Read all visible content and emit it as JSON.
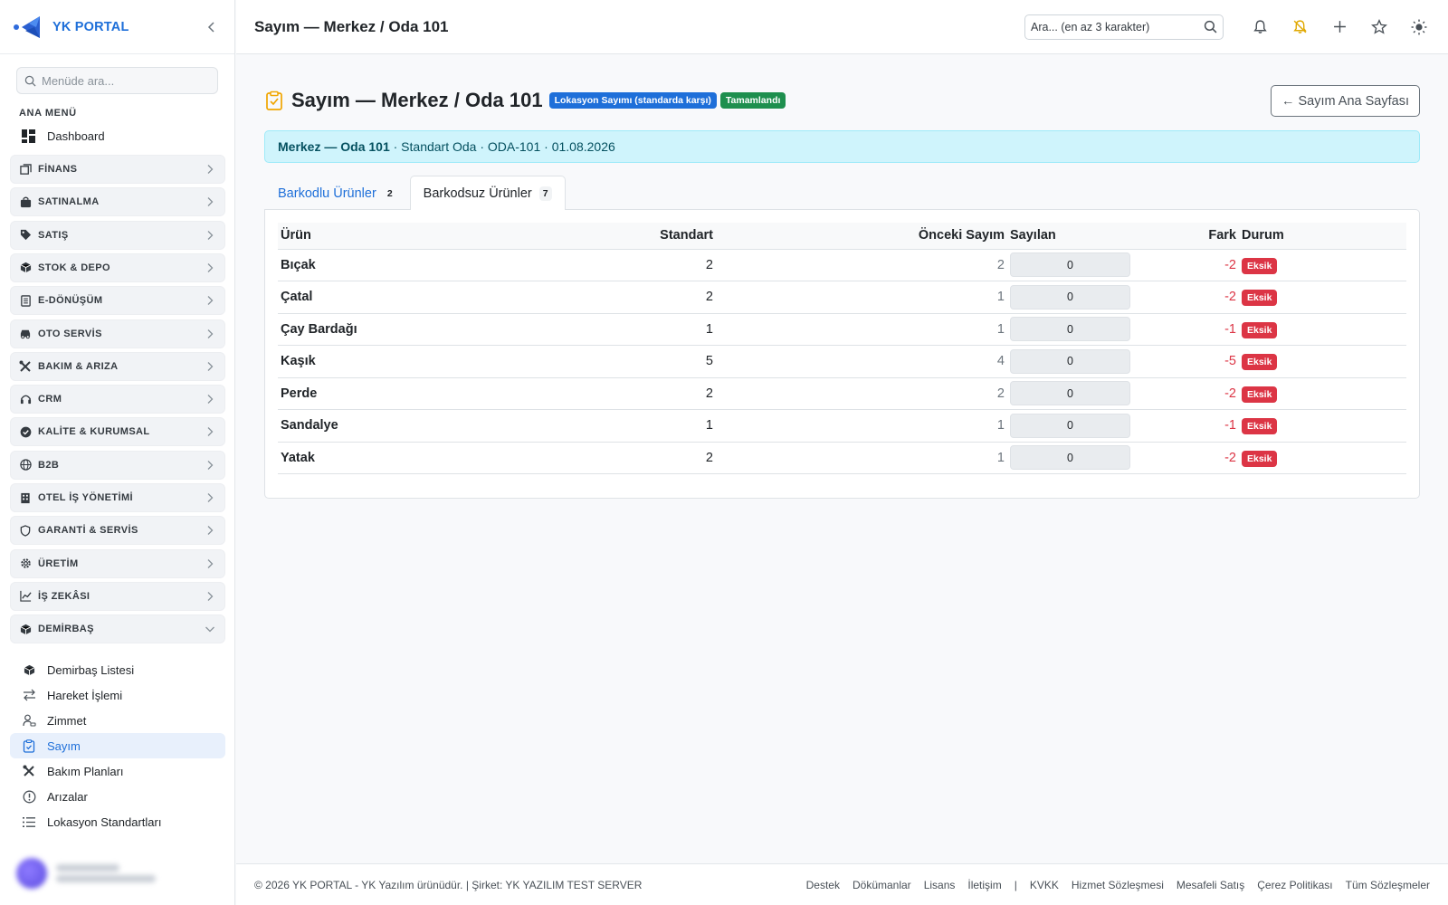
{
  "app": {
    "name": "YK PORTAL"
  },
  "sidebar": {
    "search_placeholder": "Menüde ara...",
    "section_title": "ANA MENÜ",
    "dashboard": "Dashboard",
    "groups": [
      {
        "label": "FİNANS",
        "icon": "finance-icon"
      },
      {
        "label": "SATINALMA",
        "icon": "bag-icon"
      },
      {
        "label": "SATIŞ",
        "icon": "tag-icon"
      },
      {
        "label": "STOK & DEPO",
        "icon": "box-icon"
      },
      {
        "label": "E-DÖNÜŞÜM",
        "icon": "document-icon"
      },
      {
        "label": "OTO SERVİS",
        "icon": "car-icon"
      },
      {
        "label": "BAKIM & ARIZA",
        "icon": "tools-icon"
      },
      {
        "label": "CRM",
        "icon": "headset-icon"
      },
      {
        "label": "KALİTE & KURUMSAL",
        "icon": "check-badge-icon"
      },
      {
        "label": "B2B",
        "icon": "globe-icon"
      },
      {
        "label": "OTEL İŞ YÖNETİMİ",
        "icon": "building-icon"
      },
      {
        "label": "GARANTİ & SERVİS",
        "icon": "shield-icon"
      },
      {
        "label": "ÜRETİM",
        "icon": "gear-icon"
      },
      {
        "label": "İŞ ZEKÂSI",
        "icon": "chart-icon"
      },
      {
        "label": "DEMİRBAŞ",
        "icon": "box-icon"
      }
    ],
    "sub_items": [
      {
        "label": "Demirbaş Listesi",
        "icon": "box-icon"
      },
      {
        "label": "Hareket İşlemi",
        "icon": "arrows-icon"
      },
      {
        "label": "Zimmet",
        "icon": "person-icon"
      },
      {
        "label": "Sayım",
        "icon": "clipboard-icon"
      },
      {
        "label": "Bakım Planları",
        "icon": "tools-icon"
      },
      {
        "label": "Arızalar",
        "icon": "alert-icon"
      },
      {
        "label": "Lokasyon Standartları",
        "icon": "list-icon"
      }
    ]
  },
  "topbar": {
    "title": "Sayım — Merkez / Oda 101",
    "search_placeholder": "Ara... (en az 3 karakter)"
  },
  "page": {
    "title": "Sayım — Merkez / Oda 101",
    "badge_type": "Lokasyon Sayımı (standarda karşı)",
    "badge_status": "Tamamlandı",
    "back_button": "← Sayım Ana Sayfası",
    "info_bold": "Merkez — Oda 101",
    "info_rest": " · Standart Oda · ODA-101 · 01.08.2026"
  },
  "tabs": [
    {
      "label": "Barkodlu Ürünler",
      "count": "2"
    },
    {
      "label": "Barkodsuz Ürünler",
      "count": "7"
    }
  ],
  "table": {
    "headers": [
      "Ürün",
      "Standart",
      "Önceki Sayım",
      "Sayılan",
      "Fark",
      "Durum"
    ],
    "rows": [
      {
        "name": "Bıçak",
        "standard": "2",
        "previous": "2",
        "counted": "0",
        "diff": "-2",
        "status": "Eksik"
      },
      {
        "name": "Çatal",
        "standard": "2",
        "previous": "1",
        "counted": "0",
        "diff": "-2",
        "status": "Eksik"
      },
      {
        "name": "Çay Bardağı",
        "standard": "1",
        "previous": "1",
        "counted": "0",
        "diff": "-1",
        "status": "Eksik"
      },
      {
        "name": "Kaşık",
        "standard": "5",
        "previous": "4",
        "counted": "0",
        "diff": "-5",
        "status": "Eksik"
      },
      {
        "name": "Perde",
        "standard": "2",
        "previous": "2",
        "counted": "0",
        "diff": "-2",
        "status": "Eksik"
      },
      {
        "name": "Sandalye",
        "standard": "1",
        "previous": "1",
        "counted": "0",
        "diff": "-1",
        "status": "Eksik"
      },
      {
        "name": "Yatak",
        "standard": "2",
        "previous": "1",
        "counted": "0",
        "diff": "-2",
        "status": "Eksik"
      }
    ]
  },
  "footer": {
    "copyright": "© 2026 YK PORTAL - YK Yazılım ürünüdür. | Şirket: YK YAZILIM TEST SERVER",
    "links": [
      "Destek",
      "Dökümanlar",
      "Lisans",
      "İletişim"
    ],
    "separator": "|",
    "legal_links": [
      "KVKK",
      "Hizmet Sözleşmesi",
      "Mesafeli Satış",
      "Çerez Politikası",
      "Tüm Sözleşmeler"
    ]
  },
  "colors": {
    "accent": "#1e6fd9",
    "success": "#1e8f4e",
    "danger": "#dc3545",
    "info_bg": "#cff4fc"
  }
}
